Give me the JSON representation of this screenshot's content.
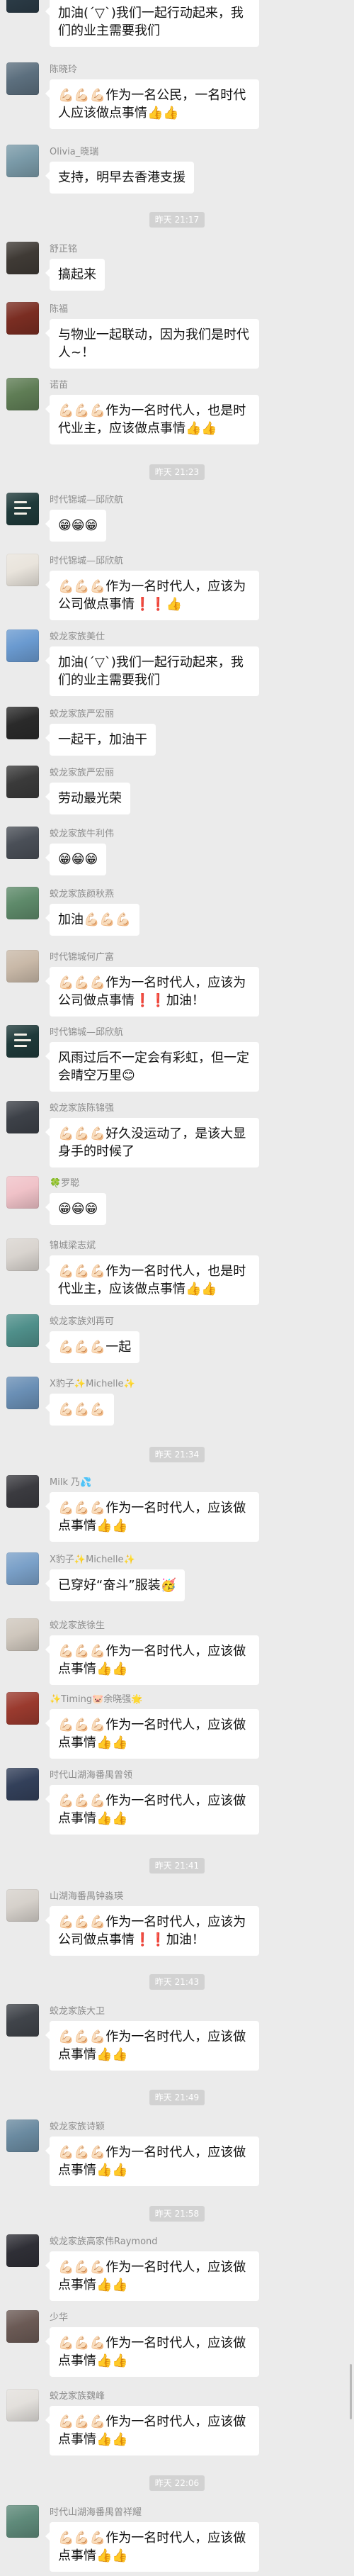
{
  "chat": {
    "items": [
      {
        "kind": "message",
        "text": "加油(ˊ▽ˋ)我们一起行动起来，我们的业主需要我们",
        "avatar": "photo",
        "avatar_color": "#2b3b46"
      },
      {
        "kind": "message",
        "sender": "陈晓玲",
        "text": "💪🏻💪🏻💪🏻作为一名公民，一名时代人应该做点事情👍👍",
        "avatar": "photo",
        "avatar_color": "#5c6f7e"
      },
      {
        "kind": "message",
        "sender": "Olivia_晓瑞",
        "text": "支持，明早去香港支援",
        "avatar": "photo",
        "avatar_color": "#7a9aa8"
      },
      {
        "kind": "time",
        "text": "昨天 21:17"
      },
      {
        "kind": "message",
        "sender": "舒正铭",
        "text": "搞起来",
        "avatar": "photo",
        "avatar_color": "#3f3a35"
      },
      {
        "kind": "message",
        "sender": "陈福",
        "text": "与物业一起联动，因为我们是时代人~！",
        "avatar": "photo",
        "avatar_color": "#7a2d22"
      },
      {
        "kind": "message",
        "sender": "诺苗",
        "text": "💪🏻💪🏻💪🏻作为一名时代人，也是时代业主，应该做点事情👍👍",
        "avatar": "photo",
        "avatar_color": "#5f7d55"
      },
      {
        "kind": "time",
        "text": "昨天 21:23"
      },
      {
        "kind": "message",
        "sender": "时代锦城—邱欣航",
        "text": "😁😁😁",
        "avatar": "times-logo",
        "avatar_color": "#1f3a3a"
      },
      {
        "kind": "message",
        "sender": "时代锦城—邱欣航",
        "text": "💪🏻💪🏻💪🏻作为一名时代人，应该为公司做点事情❗❗👍",
        "avatar": "photo",
        "avatar_color": "#e9e4dc"
      },
      {
        "kind": "message",
        "sender": "蛟龙家族美仕",
        "text": "加油(ˊ▽ˋ)我们一起行动起来，我们的业主需要我们",
        "avatar": "photo",
        "avatar_color": "#6a9ad0"
      },
      {
        "kind": "message",
        "sender": "蛟龙家族严宏丽",
        "text": "一起干，加油干",
        "avatar": "photo",
        "avatar_color": "#2a2a2a"
      },
      {
        "kind": "message",
        "sender": "蛟龙家族严宏丽",
        "text": "劳动最光荣",
        "avatar": "photo",
        "avatar_color": "#3a3a3a"
      },
      {
        "kind": "message",
        "sender": "蛟龙家族牛利伟",
        "text": "😁😁😁",
        "avatar": "photo",
        "avatar_color": "#4a4f57"
      },
      {
        "kind": "message",
        "sender": "蛟龙家族颜秋燕",
        "text": "加油💪🏻💪🏻💪🏻",
        "avatar": "photo",
        "avatar_color": "#5e8a6a"
      },
      {
        "kind": "message",
        "sender": "时代锦城何广富",
        "text": "💪🏻💪🏻💪🏻作为一名时代人，应该为公司做点事情❗❗加油！",
        "avatar": "photo",
        "avatar_color": "#c9b9a8"
      },
      {
        "kind": "message",
        "sender": "时代锦城—邱欣航",
        "text": "风雨过后不一定会有彩虹，但一定会晴空万里😊",
        "avatar": "times-logo",
        "avatar_color": "#1f3a3a"
      },
      {
        "kind": "message",
        "sender": "蛟龙家族陈锦强",
        "text": "💪🏻💪🏻💪🏻好久没运动了，是该大显身手的时候了",
        "avatar": "photo",
        "avatar_color": "#3d4148"
      },
      {
        "kind": "message",
        "sender": "🍀罗聪",
        "text": "😁😁😁",
        "avatar": "photo",
        "avatar_color": "#f0c2c8"
      },
      {
        "kind": "message",
        "sender": "锦城梁志斌",
        "text": "💪🏻💪🏻💪🏻作为一名时代人，也是时代业主，应该做点事情👍👍",
        "avatar": "photo",
        "avatar_color": "#d9d4cf"
      },
      {
        "kind": "message",
        "sender": "蛟龙家族刘再可",
        "text": "💪🏻💪🏻💪🏻一起",
        "avatar": "photo",
        "avatar_color": "#4f8f8a"
      },
      {
        "kind": "message",
        "sender": "X豹子✨Michelle✨",
        "text": "💪🏻💪🏻💪🏻",
        "avatar": "photo",
        "avatar_color": "#6a8fb5"
      },
      {
        "kind": "time",
        "text": "昨天 21:34"
      },
      {
        "kind": "message",
        "sender": "Milk 乃💦",
        "text": "💪🏻💪🏻💪🏻作为一名时代人，应该做点事情👍👍",
        "avatar": "photo",
        "avatar_color": "#3b3b40"
      },
      {
        "kind": "message",
        "sender": "X豹子✨Michelle✨",
        "text": "已穿好“奋斗”服装🥳",
        "avatar": "photo",
        "avatar_color": "#7aa0c8"
      },
      {
        "kind": "message",
        "sender": "蛟龙家族徐生",
        "text": "💪🏻💪🏻💪🏻作为一名时代人，应该做点事情👍👍",
        "avatar": "photo",
        "avatar_color": "#cfc7bd"
      },
      {
        "kind": "message",
        "sender": "✨Timing🐷余晓强🌟",
        "text": "💪🏻💪🏻💪🏻作为一名时代人，应该做点事情👍👍",
        "avatar": "photo",
        "avatar_color": "#9a3a2e"
      },
      {
        "kind": "message",
        "sender": "时代山湖海番禺曾领",
        "text": "💪🏻💪🏻💪🏻作为一名时代人，应该做点事情👍👍",
        "avatar": "photo",
        "avatar_color": "#33405a"
      },
      {
        "kind": "time",
        "text": "昨天 21:41"
      },
      {
        "kind": "message",
        "sender": "山湖海番禺钟淼瑛",
        "text": "💪🏻💪🏻💪🏻作为一名时代人，应该为公司做点事情❗❗加油！",
        "avatar": "photo",
        "avatar_color": "#d6d1cb"
      },
      {
        "kind": "time",
        "text": "昨天 21:43"
      },
      {
        "kind": "message",
        "sender": "蛟龙家族大卫",
        "text": "💪🏻💪🏻💪🏻作为一名时代人，应该做点事情👍👍",
        "avatar": "photo",
        "avatar_color": "#40444a"
      },
      {
        "kind": "time",
        "text": "昨天 21:49"
      },
      {
        "kind": "message",
        "sender": "蛟龙家族诗颖",
        "text": "💪🏻💪🏻💪🏻作为一名时代人，应该做点事情👍👍",
        "avatar": "photo",
        "avatar_color": "#6a8aa0"
      },
      {
        "kind": "time",
        "text": "昨天 21:58"
      },
      {
        "kind": "message",
        "sender": "蛟龙家族高家伟Raymond",
        "text": "💪🏻💪🏻💪🏻作为一名时代人，应该做点事情👍👍",
        "avatar": "photo",
        "avatar_color": "#2f2f36"
      },
      {
        "kind": "message",
        "sender": "少华",
        "text": "💪🏻💪🏻💪🏻作为一名时代人，应该做点事情👍👍",
        "avatar": "photo",
        "avatar_color": "#6b5a55"
      },
      {
        "kind": "message",
        "sender": "蛟龙家族魏峰",
        "text": "💪🏻💪🏻💪🏻作为一名时代人，应该做点事情👍👍",
        "avatar": "photo",
        "avatar_color": "#e3e0dc"
      },
      {
        "kind": "time",
        "text": "昨天 22:06"
      },
      {
        "kind": "message",
        "sender": "时代山湖海番禺曾祥耀",
        "text": "💪🏻💪🏻💪🏻作为一名时代人，应该做点事情👍👍",
        "avatar": "photo",
        "avatar_color": "#5f8a7a"
      }
    ]
  },
  "colors": {
    "background": "#ebebeb",
    "bubble": "#ffffff",
    "timestamp_chip": "#d2d2d2"
  }
}
